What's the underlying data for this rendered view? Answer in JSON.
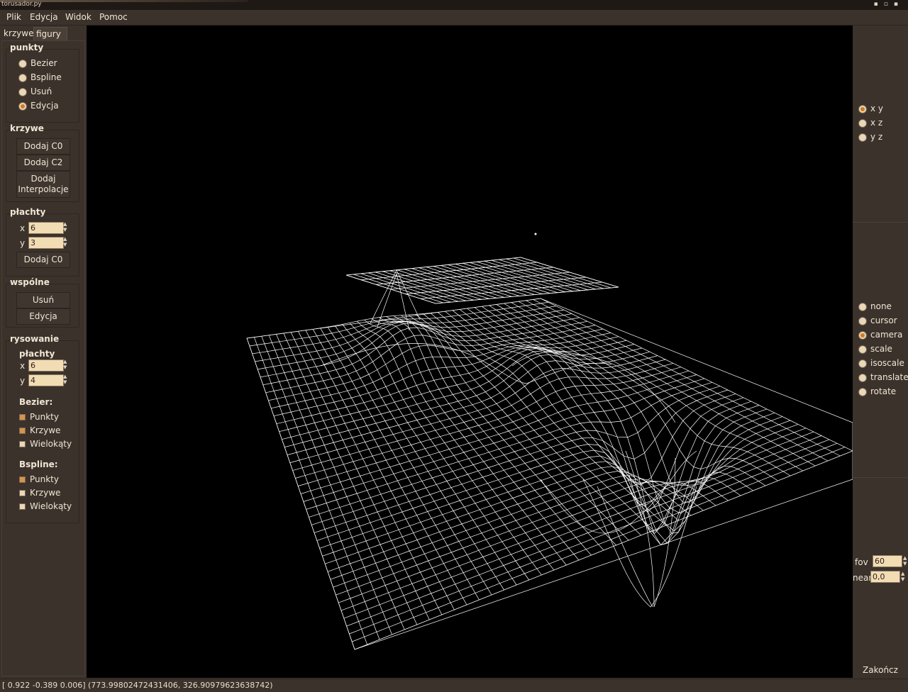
{
  "window": {
    "title": "torusador.py",
    "controls_icons": [
      "minimize-icon",
      "maximize-icon",
      "close-icon"
    ]
  },
  "menu": {
    "items": [
      "Plik",
      "Edycja",
      "Widok",
      "Pomoc"
    ]
  },
  "left_panel": {
    "tabs": [
      "krzywe",
      "figury"
    ],
    "punkty": {
      "label": "punkty",
      "options": [
        "Bezier",
        "Bspline",
        "Usuń",
        "Edycja"
      ],
      "selected": "Edycja"
    },
    "krzywe": {
      "label": "krzywe",
      "buttons": [
        "Dodaj C0",
        "Dodaj C2",
        "Dodaj\nInterpolacje"
      ]
    },
    "plachty": {
      "label": "płachty",
      "x_label": "x",
      "x_value": "6",
      "y_label": "y",
      "y_value": "3",
      "button": "Dodaj C0"
    },
    "wspolne": {
      "label": "wspólne",
      "buttons": [
        "Usuń",
        "Edycja"
      ]
    },
    "rysowanie": {
      "label": "rysowanie",
      "plachty_label": "płachty",
      "x_label": "x",
      "x_value": "6",
      "y_label": "y",
      "y_value": "4",
      "bezier_label": "Bezier:",
      "bezier_items": [
        {
          "label": "Punkty",
          "checked": true
        },
        {
          "label": "Krzywe",
          "checked": true
        },
        {
          "label": "Wielokąty",
          "checked": false
        }
      ],
      "bspline_label": "Bspline:",
      "bspline_items": [
        {
          "label": "Punkty",
          "checked": true
        },
        {
          "label": "Krzywe",
          "checked": false
        },
        {
          "label": "Wielokąty",
          "checked": false
        }
      ]
    }
  },
  "right_panel": {
    "planes": {
      "options": [
        "x y",
        "x z",
        "y z"
      ],
      "selected": "x y"
    },
    "modes": {
      "options": [
        "none",
        "cursor",
        "camera",
        "scale",
        "isoscale",
        "translate",
        "rotate"
      ],
      "selected": "camera"
    },
    "fov_label": "fov",
    "fov_value": "60",
    "near_label": "near",
    "near_value": "0,0",
    "quit_label": "Zakończ"
  },
  "status": {
    "text": "[ 0.922 -0.389  0.006]  (773.99802472431406, 326.90979623638742)"
  },
  "colors": {
    "background": "#3b322c",
    "viewport": "#000000",
    "accent_orange": "#d07a20",
    "input_bg": "#f2dcb4",
    "wireframe": "#ffffff"
  }
}
